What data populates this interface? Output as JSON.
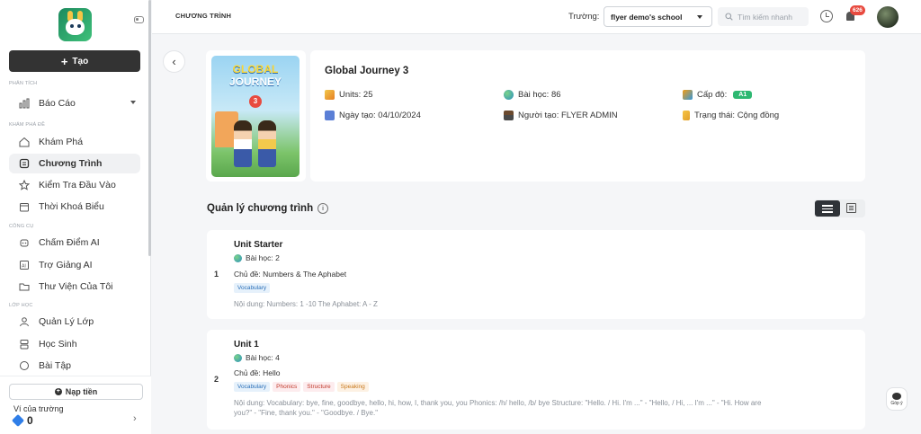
{
  "sidebar": {
    "create_label": "Tạo",
    "sections": [
      {
        "title": "PHÂN TÍCH",
        "items": [
          {
            "label": "Báo Cáo",
            "icon": "bar-chart-icon"
          }
        ]
      },
      {
        "title": "KHÁM PHÁ ĐỀ",
        "items": [
          {
            "label": "Khám Phá",
            "icon": "home-icon"
          },
          {
            "label": "Chương Trình",
            "icon": "program-icon"
          },
          {
            "label": "Kiểm Tra Đầu Vào",
            "icon": "star-icon"
          },
          {
            "label": "Thời Khoá Biểu",
            "icon": "calendar-icon"
          }
        ]
      },
      {
        "title": "CÔNG CỤ",
        "items": [
          {
            "label": "Chấm Điểm AI",
            "icon": "robot-icon"
          },
          {
            "label": "Trợ Giảng AI",
            "icon": "ai-icon"
          },
          {
            "label": "Thư Viện Của Tôi",
            "icon": "folder-icon"
          }
        ]
      },
      {
        "title": "LỚP HỌC",
        "items": [
          {
            "label": "Quản Lý Lớp",
            "icon": "class-icon"
          },
          {
            "label": "Học Sinh",
            "icon": "students-icon"
          },
          {
            "label": "Bài Tập",
            "icon": "homework-icon"
          }
        ]
      }
    ],
    "topup_label": "Nạp tiền",
    "wallet_label": "Ví của trường",
    "wallet_value": "0"
  },
  "header": {
    "breadcrumb": "CHƯƠNG TRÌNH",
    "school_label": "Trường:",
    "school_value": "flyer demo's school",
    "search_placeholder": "Tìm kiếm nhanh",
    "notification_count": "626"
  },
  "book": {
    "cover_line1": "GLOBAL",
    "cover_line2": "JOURNEY",
    "cover_number": "3",
    "title": "Global Journey 3",
    "units": "Units: 25",
    "lessons": "Bài học: 86",
    "level_label": "Cấp độ:",
    "level_value": "A1",
    "created_date": "Ngày tạo: 04/10/2024",
    "creator": "Người tạo: FLYER ADMIN",
    "status": "Trạng thái: Cộng đồng"
  },
  "program": {
    "section_title": "Quản lý chương trình",
    "units": [
      {
        "index": "1",
        "title": "Unit Starter",
        "lessons": "Bài học: 2",
        "topic": "Chủ đề: Numbers & The Aphabet",
        "tags": [
          "Vocabulary"
        ],
        "content": "Nội dung: Numbers: 1 -10 The Aphabet: A - Z"
      },
      {
        "index": "2",
        "title": "Unit 1",
        "lessons": "Bài học: 4",
        "topic": "Chủ đề: Hello",
        "tags": [
          "Vocabulary",
          "Phonics",
          "Structure",
          "Speaking"
        ],
        "content": "Nội dung: Vocabulary: bye, fine, goodbye, hello, hi, how, I, thank you, you Phonics: /h/ hello, /b/ bye Structure: \"Hello. / Hi. I'm ...\" - \"Hello, / Hi, ... I'm ...\" - \"Hi. How are you?\" - \"Fine, thank you.\" - \"Goodbye. / Bye.\""
      }
    ]
  },
  "feedback_label": "Góp ý",
  "colors": {
    "primary_dark": "#333333",
    "level_green": "#2eb872",
    "badge_red": "#e84a3f"
  }
}
